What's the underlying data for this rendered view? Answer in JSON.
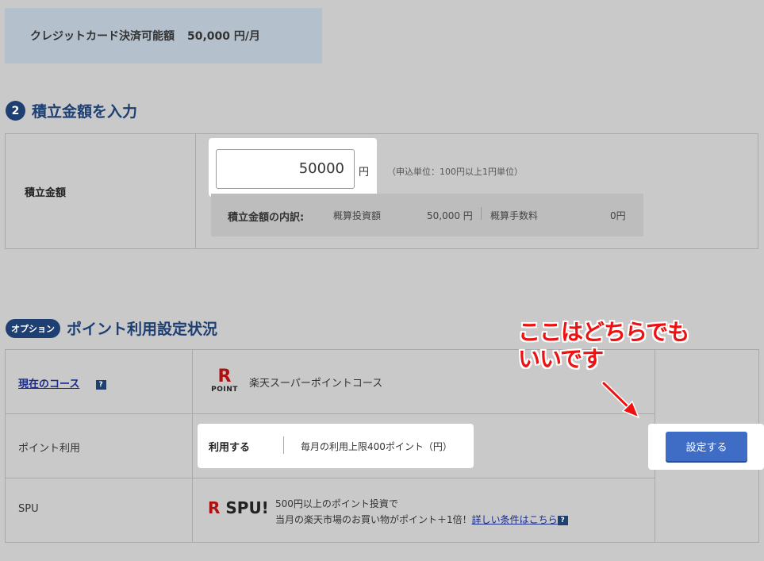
{
  "credit": {
    "label": "クレジットカード決済可能額",
    "amount": "50,000 円/月"
  },
  "section_amount": {
    "step": "2",
    "title": "積立金額を入力",
    "row_label": "積立金額",
    "input_value": "50000",
    "yen": "円",
    "unit_note": "（申込単位：100円以上1円単位）",
    "breakdown": {
      "label": "積立金額の内訳:",
      "investment_label": "概算投資額",
      "investment_value": "50,000 円",
      "fee_label": "概算手数料",
      "fee_value": "0円"
    }
  },
  "section_points": {
    "badge": "オプション",
    "title": "ポイント利用設定状況",
    "course_label": "現在のコース",
    "help": "?",
    "course_logo_r": "R",
    "course_logo_text": "POINT",
    "course_value": "楽天スーパーポイントコース",
    "use_label": "ポイント利用",
    "use_value": "利用する",
    "use_limit": "毎月の利用上限400ポイント（円）",
    "set_button": "設定する",
    "spu_label": "SPU",
    "spu_logo_r": "R",
    "spu_logo_text": "SPU!",
    "spu_line1": "500円以上のポイント投資で",
    "spu_line2": "当月の楽天市場のお買い物がポイント＋1倍！",
    "spu_link": "詳しい条件はこちら"
  },
  "annotation": {
    "line1": "ここはどちらでも",
    "line2": "いいです"
  },
  "colors": {
    "background": "#c9c9c9",
    "navy": "#1d3f72",
    "button": "#3f6cc5",
    "annotation": "#ee1111"
  }
}
